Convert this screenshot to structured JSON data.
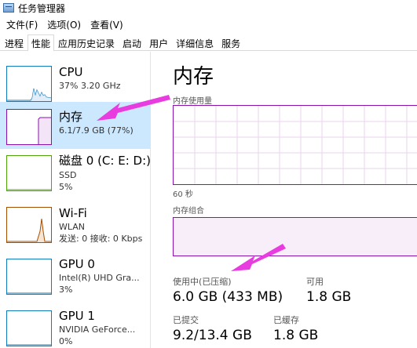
{
  "window": {
    "title": "任务管理器"
  },
  "menu": [
    "文件(F)",
    "选项(O)",
    "查看(V)"
  ],
  "tabs": [
    {
      "label": "进程",
      "active": false
    },
    {
      "label": "性能",
      "active": true
    },
    {
      "label": "应用历史记录",
      "active": false
    },
    {
      "label": "启动",
      "active": false
    },
    {
      "label": "用户",
      "active": false
    },
    {
      "label": "详细信息",
      "active": false
    },
    {
      "label": "服务",
      "active": false
    }
  ],
  "sidebar": [
    {
      "name": "CPU",
      "lines": [
        "37% 3.20 GHz"
      ],
      "color": "#117dbb",
      "selected": false
    },
    {
      "name": "内存",
      "lines": [
        "6.1/7.9 GB (77%)"
      ],
      "color": "#8b12ae",
      "selected": true
    },
    {
      "name": "磁盘 0 (C: E: D:)",
      "lines": [
        "SSD",
        "5%"
      ],
      "color": "#4da60c",
      "selected": false
    },
    {
      "name": "Wi-Fi",
      "lines": [
        "WLAN",
        "发送: 0 接收: 0 Kbps"
      ],
      "color": "#a74f01",
      "selected": false
    },
    {
      "name": "GPU 0",
      "lines": [
        "Intel(R) UHD Gra...",
        "3%"
      ],
      "color": "#117dbb",
      "selected": false
    },
    {
      "name": "GPU 1",
      "lines": [
        "NVIDIA GeForce...",
        "0%"
      ],
      "color": "#117dbb",
      "selected": false
    }
  ],
  "memory": {
    "title": "内存",
    "usage_label": "内存使用量",
    "time_label": "60 秒",
    "composition_label": "内存组合",
    "stats": {
      "in_use_label": "使用中(已压缩)",
      "in_use_value": "6.0 GB (433 MB)",
      "available_label": "可用",
      "available_value": "1.8 GB",
      "committed_label": "已提交",
      "committed_value": "9.2/13.4 GB",
      "cached_label": "已缓存",
      "cached_value": "1.8 GB"
    }
  },
  "annotations": {
    "arrow_color": "#e83be0"
  }
}
